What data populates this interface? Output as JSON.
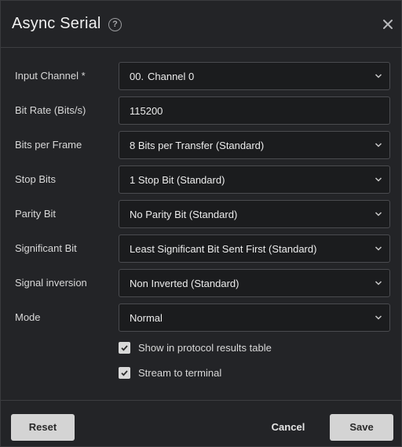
{
  "dialog": {
    "title": "Async Serial",
    "help_icon": "question-circle-icon",
    "close_icon": "close-icon"
  },
  "fields": {
    "input_channel": {
      "label": "Input Channel *",
      "number": "00.",
      "value": "Channel 0"
    },
    "bit_rate": {
      "label": "Bit Rate (Bits/s)",
      "value": "115200"
    },
    "bits_per_frame": {
      "label": "Bits per Frame",
      "value": "8 Bits per Transfer (Standard)"
    },
    "stop_bits": {
      "label": "Stop Bits",
      "value": "1 Stop Bit (Standard)"
    },
    "parity_bit": {
      "label": "Parity Bit",
      "value": "No Parity Bit (Standard)"
    },
    "significant_bit": {
      "label": "Significant Bit",
      "value": "Least Significant Bit Sent First (Standard)"
    },
    "signal_inversion": {
      "label": "Signal inversion",
      "value": "Non Inverted (Standard)"
    },
    "mode": {
      "label": "Mode",
      "value": "Normal"
    }
  },
  "checkboxes": {
    "show_in_table": {
      "label": "Show in protocol results table",
      "checked": true
    },
    "stream_to_terminal": {
      "label": "Stream to terminal",
      "checked": true
    }
  },
  "footer": {
    "reset_label": "Reset",
    "cancel_label": "Cancel",
    "save_label": "Save"
  },
  "colors": {
    "background": "#232427",
    "field_background": "#1b1c1e",
    "field_border": "#4a4b4f",
    "button_light": "#d4d4d4"
  }
}
